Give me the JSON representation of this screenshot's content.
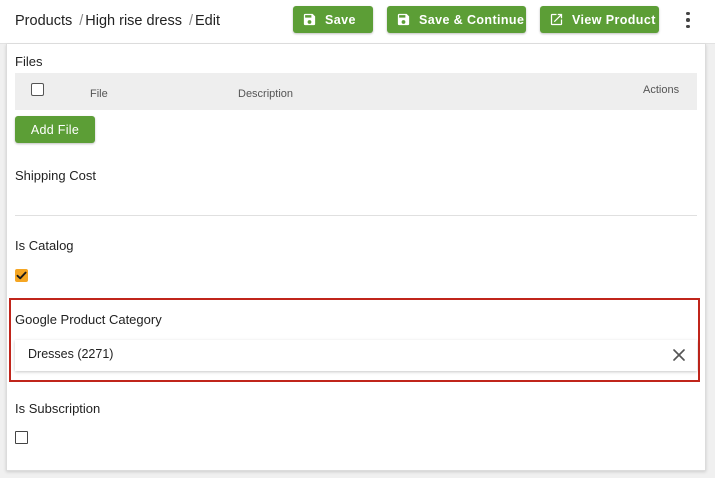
{
  "breadcrumb": {
    "root": "Products",
    "product": "High rise dress",
    "current": "Edit",
    "separator": "/"
  },
  "toolbar": {
    "save_label": "Save",
    "save_continue_label": "Save & Continue",
    "view_product_label": "View Product",
    "button_color": "#5c9e36"
  },
  "files": {
    "label": "Files",
    "columns": {
      "file": "File",
      "description": "Description",
      "actions": "Actions"
    },
    "add_button_label": "Add File"
  },
  "shipping_cost": {
    "label": "Shipping Cost",
    "value": ""
  },
  "is_catalog": {
    "label": "Is Catalog",
    "checked": true,
    "checkbox_color": "#f5a623"
  },
  "google_product_category": {
    "label": "Google Product Category",
    "value": "Dresses (2271)",
    "highlight_color": "#c0251b"
  },
  "is_subscription": {
    "label": "Is Subscription",
    "checked": false
  },
  "icons": {
    "save": "floppy-disk-icon",
    "save_continue": "floppy-disk-icon",
    "view_product": "external-link-icon",
    "more": "more-vertical-icon",
    "clear": "close-icon",
    "check": "check-icon"
  }
}
